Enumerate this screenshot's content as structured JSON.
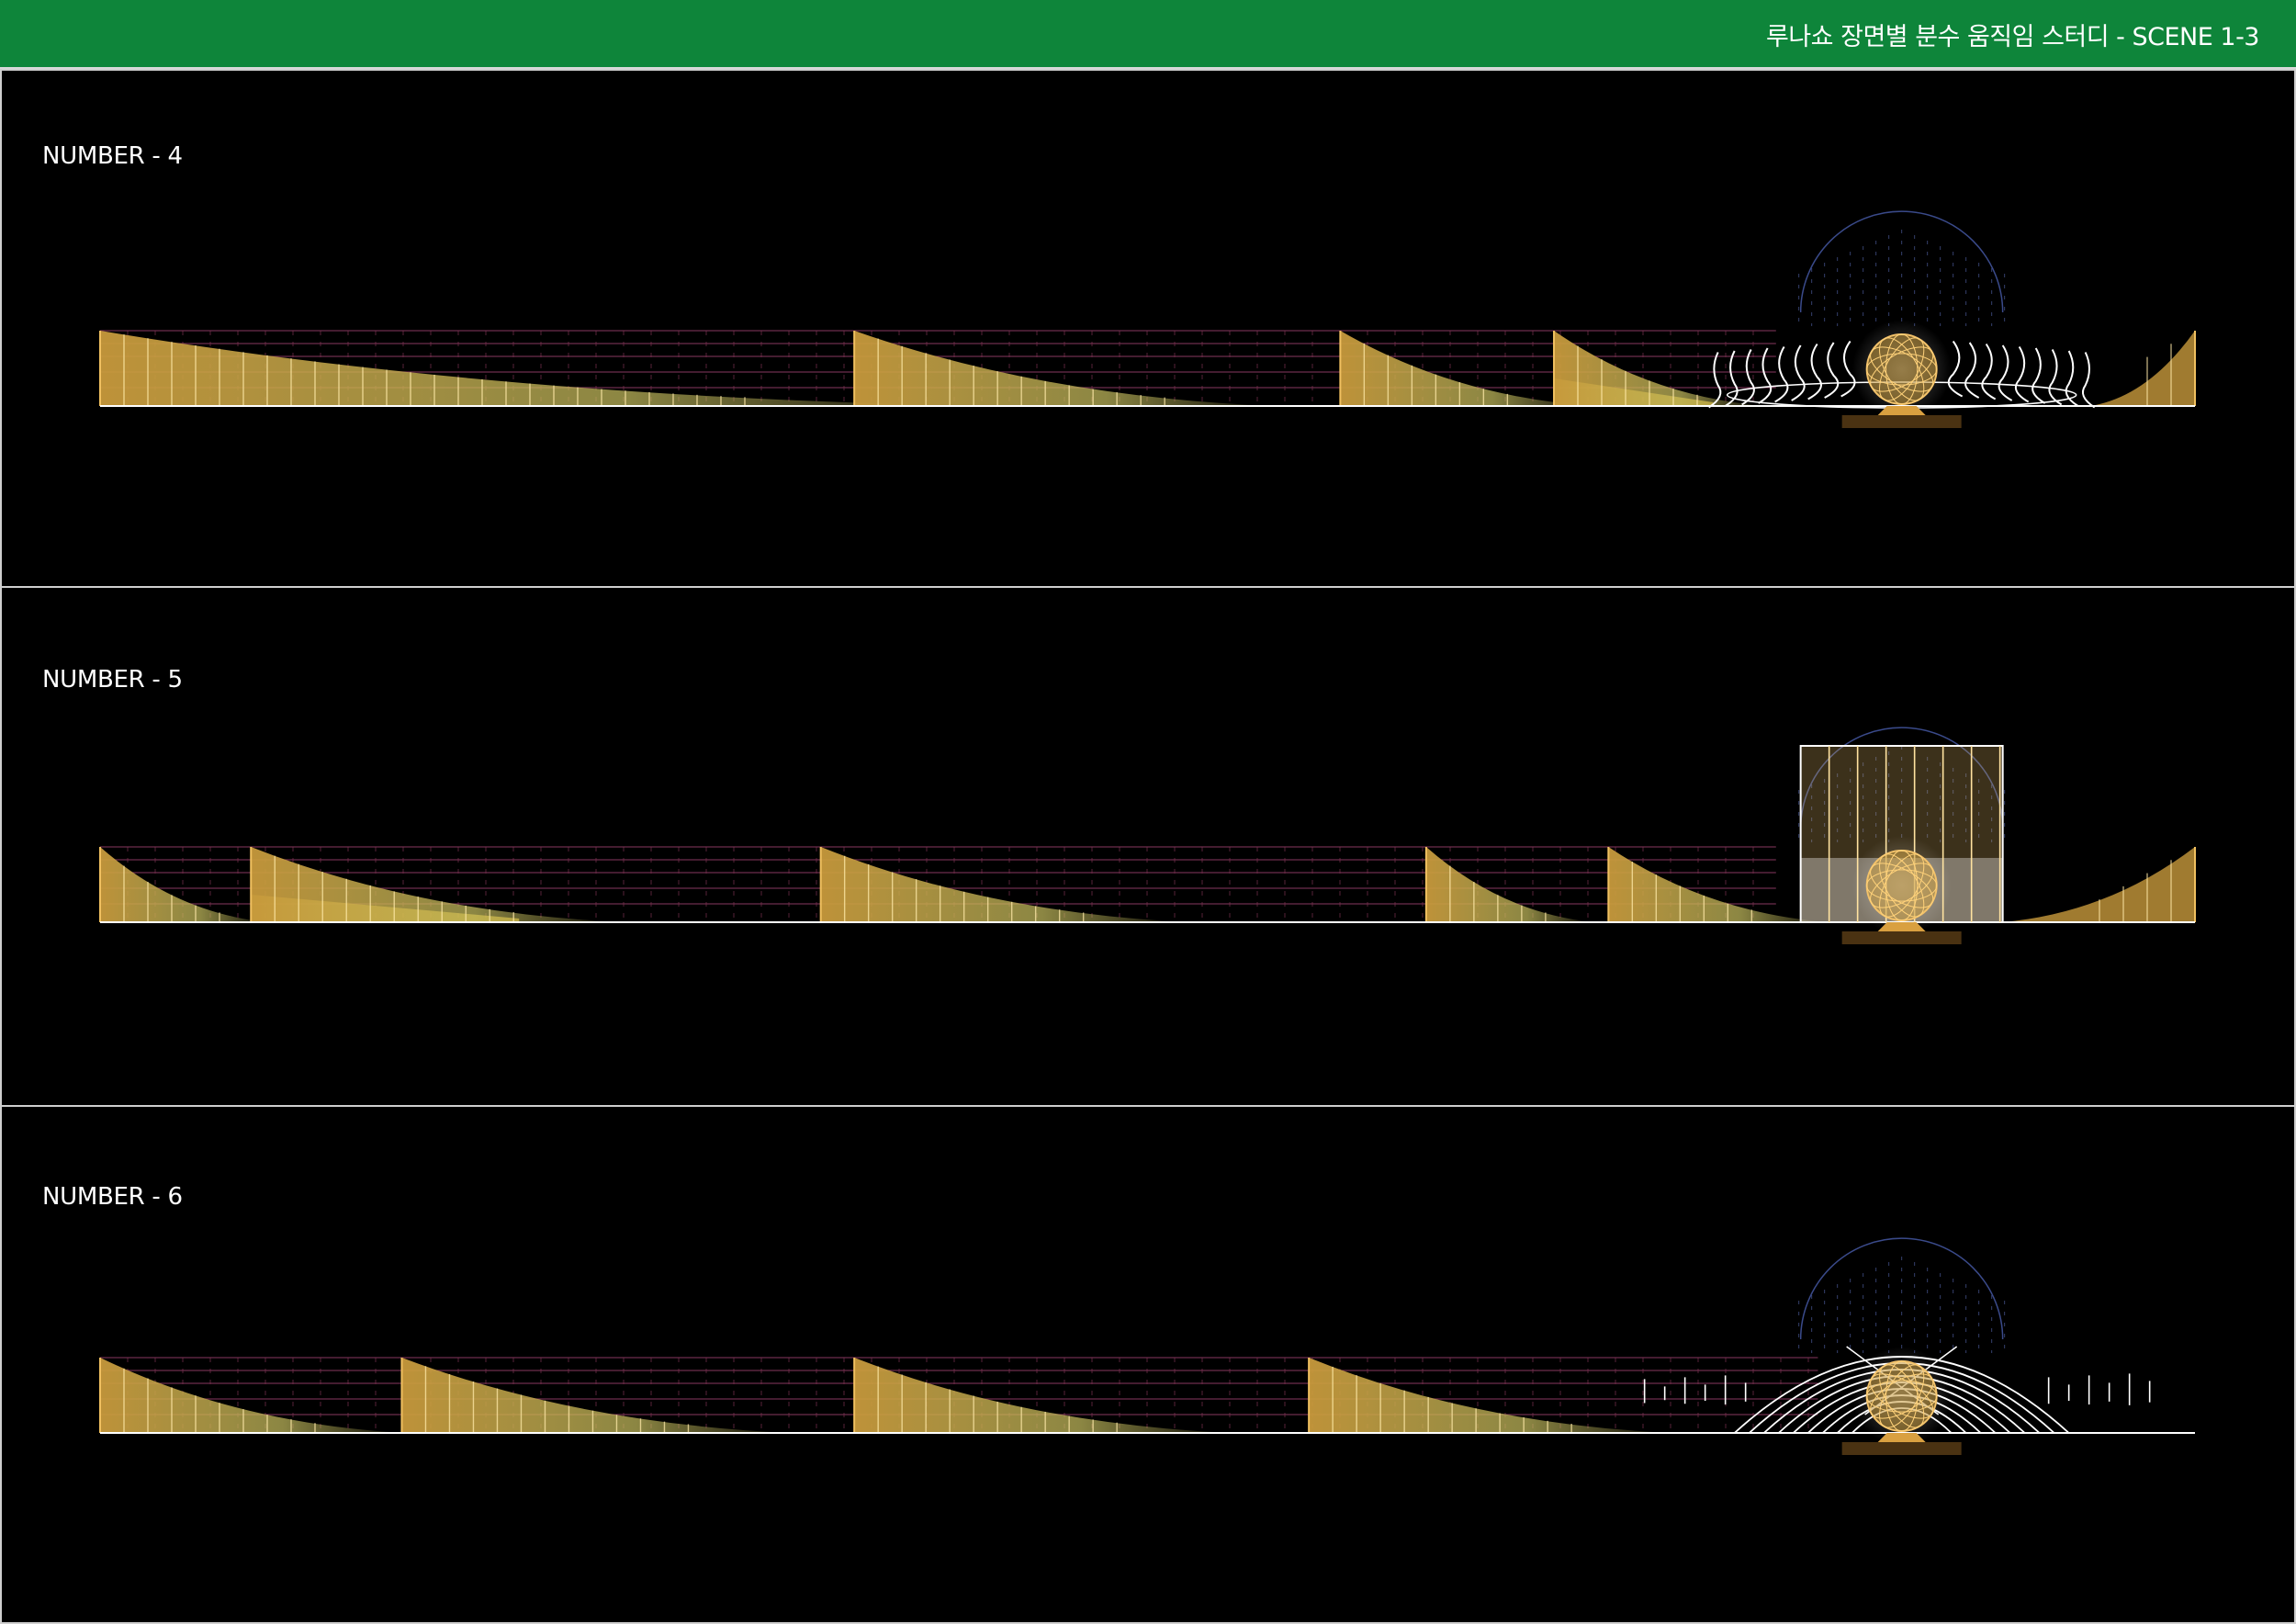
{
  "header": {
    "title": "루나쇼 장면별 분수 움직임 스터디 - SCENE 1-3"
  },
  "colors": {
    "header_bg": "#0e853a",
    "panel_border": "#cfcfcf",
    "fountain_fill": "#c89a3c",
    "highlight_fill": "#ffd23c",
    "grid_vertical": "#ffe9a8",
    "grid_horizontal": "#8a3a60",
    "globe": "#f3c26a",
    "water_stream": "#ffffff"
  },
  "scenes": [
    {
      "label": "NUMBER - 4",
      "wedges": [
        [
          0,
          0.42
        ],
        [
          0.36,
          0.56
        ],
        [
          0.592,
          0.713
        ],
        [
          0.694,
          0.795
        ]
      ],
      "mirror_wedge": [
        0.95,
        1.0
      ],
      "grid_until": 0.8,
      "highlight": [
        0.694,
        0.77
      ],
      "effect": "wave-streams",
      "globe_at": 0.86
    },
    {
      "label": "NUMBER - 5",
      "wedges": [
        [
          0,
          0.08
        ],
        [
          0.072,
          0.25
        ],
        [
          0.344,
          0.52
        ],
        [
          0.633,
          0.713
        ],
        [
          0.72,
          0.825
        ]
      ],
      "mirror_wedge": [
        0.908,
        1.0
      ],
      "grid_until": 0.8,
      "highlight": [
        0.072,
        0.2
      ],
      "effect": "curtain",
      "globe_at": 0.86
    },
    {
      "label": "NUMBER - 6",
      "wedges": [
        [
          0,
          0.145
        ],
        [
          0.144,
          0.33
        ],
        [
          0.36,
          0.54
        ],
        [
          0.577,
          0.75
        ]
      ],
      "mirror_wedge": null,
      "grid_until": 0.82,
      "highlight": null,
      "effect": "arches",
      "globe_at": 0.86
    }
  ]
}
